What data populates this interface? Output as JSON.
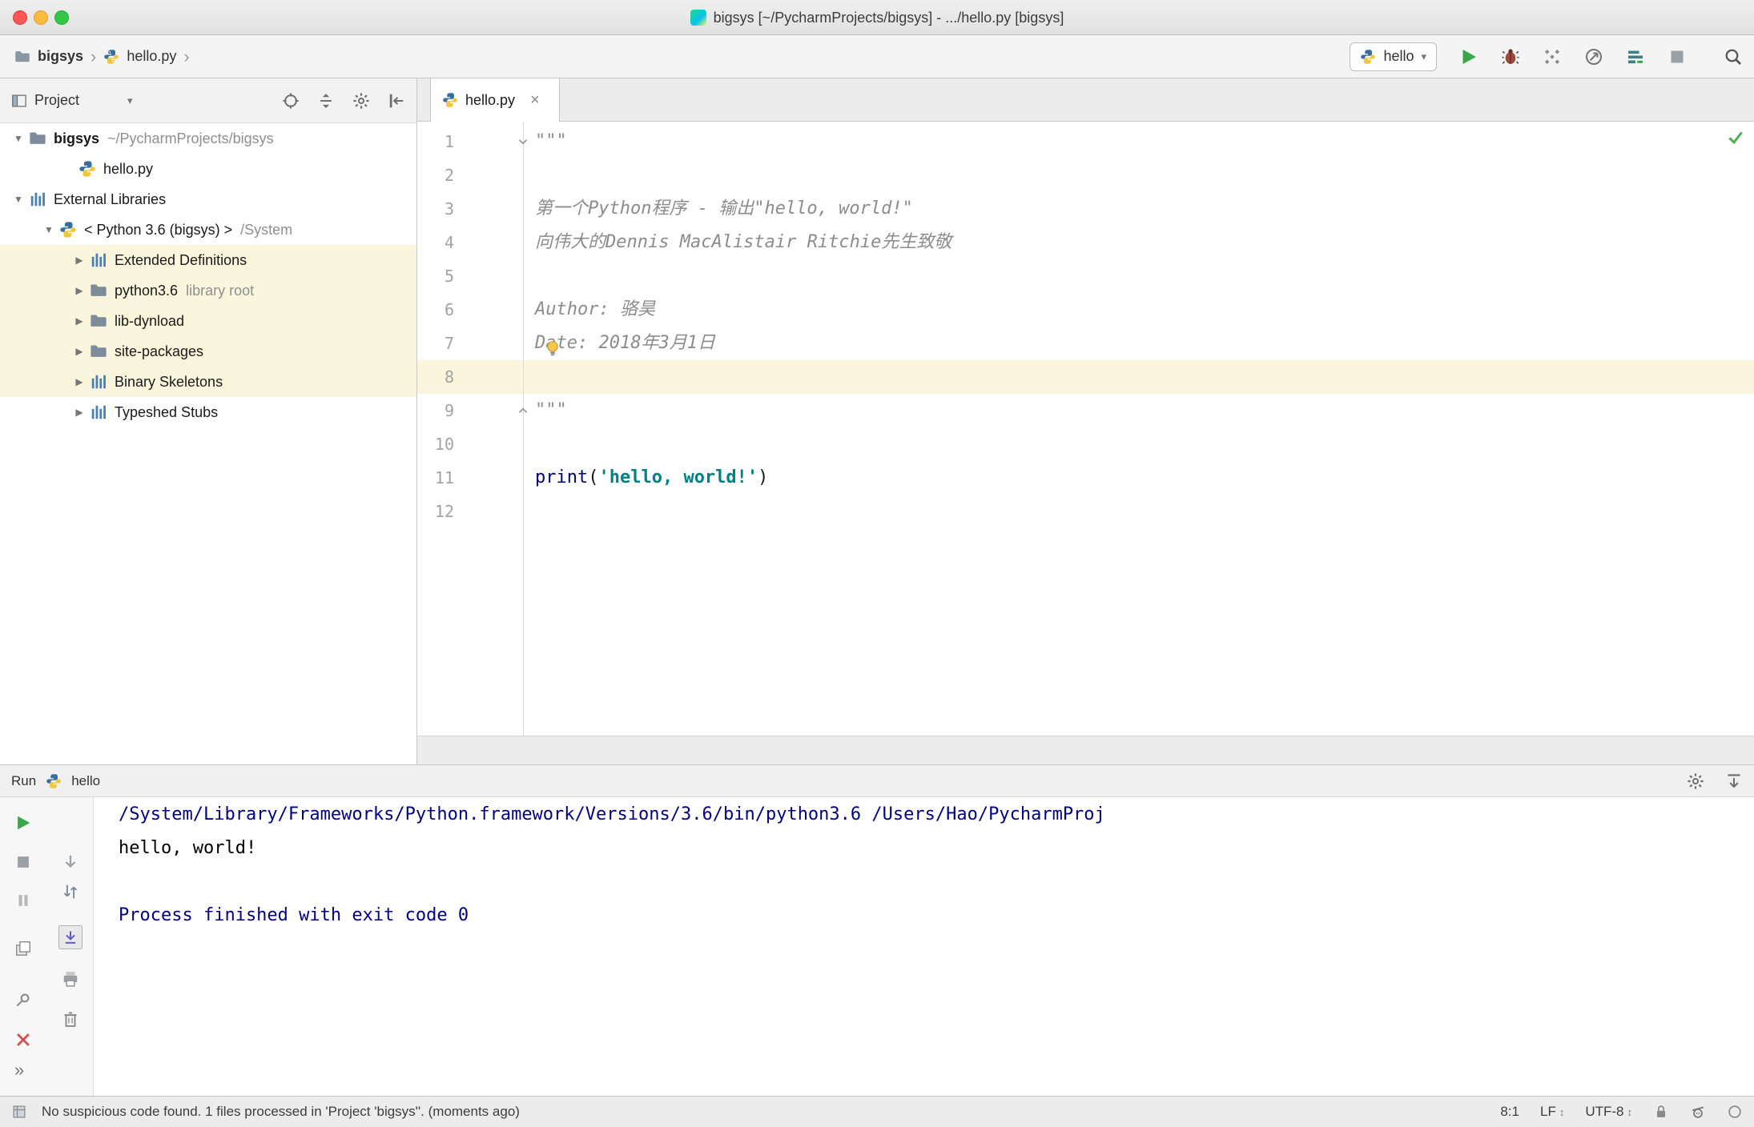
{
  "titlebar": {
    "title": "bigsys [~/PycharmProjects/bigsys] - .../hello.py [bigsys]"
  },
  "icons": {
    "caret_down": "▾",
    "crumb_sep": "›",
    "tree_expanded": "▼",
    "tree_collapsed": "▶",
    "close": "×",
    "more_chevrons": "»",
    "updown": "↕"
  },
  "navbar": {
    "crumbs": {
      "project": "bigsys",
      "file": "hello.py"
    },
    "run_config": "hello"
  },
  "project": {
    "header": "Project",
    "rows": [
      {
        "label": "bigsys",
        "ann": "~/PycharmProjects/bigsys"
      },
      {
        "label": "hello.py"
      },
      {
        "label": "External Libraries"
      },
      {
        "label": "< Python 3.6 (bigsys) >",
        "ann": "/System"
      },
      {
        "label": "Extended Definitions"
      },
      {
        "label": "python3.6",
        "ann": "library root"
      },
      {
        "label": "lib-dynload"
      },
      {
        "label": "site-packages"
      },
      {
        "label": "Binary Skeletons"
      },
      {
        "label": "Typeshed Stubs"
      }
    ]
  },
  "editor": {
    "tab": "hello.py",
    "lines": [
      {
        "num": "1",
        "doc": "\"\"\""
      },
      {
        "num": "2"
      },
      {
        "num": "3",
        "doc": "第一个Python程序 - 输出\"hello, world!\""
      },
      {
        "num": "4",
        "doc": "向伟大的Dennis MacAlistair Ritchie先生致敬"
      },
      {
        "num": "5"
      },
      {
        "num": "6",
        "doc": "Author: 骆昊"
      },
      {
        "num": "7",
        "doc": "Date: 2018年3月1日"
      },
      {
        "num": "8"
      },
      {
        "num": "9",
        "doc": "\"\"\""
      },
      {
        "num": "10"
      },
      {
        "num": "11",
        "func": "print",
        "lparen": "(",
        "str": "'hello, world!'",
        "rparen": ")"
      },
      {
        "num": "12"
      }
    ]
  },
  "run": {
    "title": "Run",
    "tab": "hello",
    "console": {
      "line1": "/System/Library/Frameworks/Python.framework/Versions/3.6/bin/python3.6 /Users/Hao/PycharmProj",
      "line2": "hello, world!",
      "line4": "Process finished with exit code 0"
    }
  },
  "status": {
    "message": "No suspicious code found. 1 files processed in 'Project 'bigsys''. (moments ago)",
    "caret_pos": "8:1",
    "line_sep": "LF",
    "encoding": "UTF-8"
  },
  "colors": {
    "run_green": "#3aa648",
    "console_navy": "#000080",
    "string_teal": "#008080",
    "docstring_gray": "#8c8c8c",
    "caret_line_bg": "#faf5dc"
  }
}
